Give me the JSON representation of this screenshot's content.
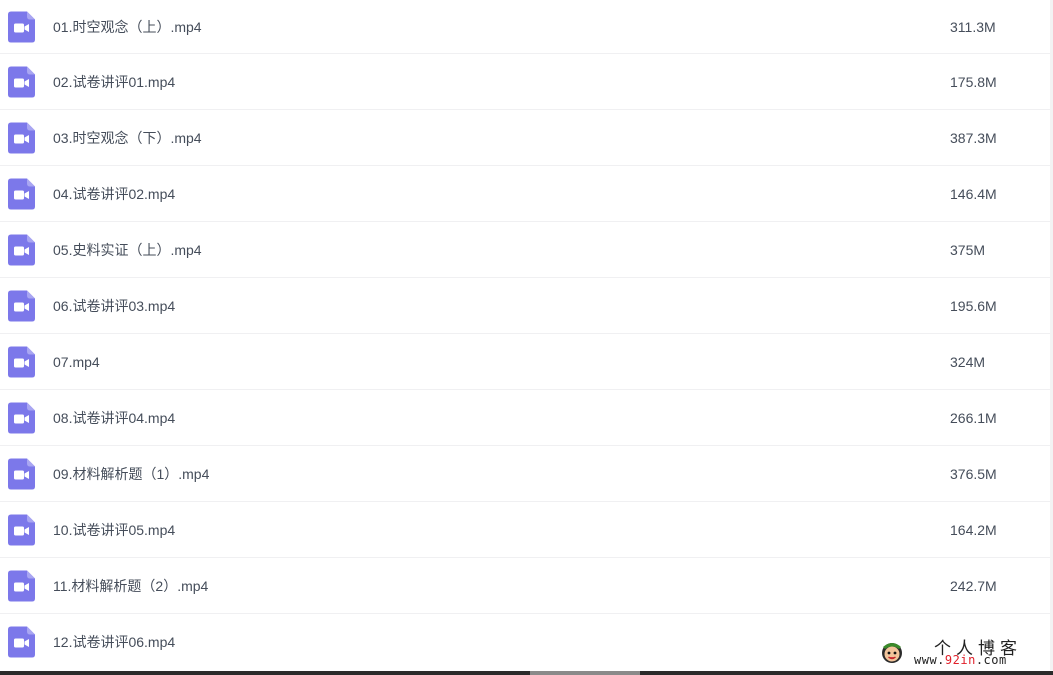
{
  "files": [
    {
      "name": "01.时空观念（上）.mp4",
      "size": "311.3M",
      "icon": "video-file-icon"
    },
    {
      "name": "02.试卷讲评01.mp4",
      "size": "175.8M",
      "icon": "video-file-icon"
    },
    {
      "name": "03.时空观念（下）.mp4",
      "size": "387.3M",
      "icon": "video-file-icon"
    },
    {
      "name": "04.试卷讲评02.mp4",
      "size": "146.4M",
      "icon": "video-file-icon"
    },
    {
      "name": "05.史料实证（上）.mp4",
      "size": "375M",
      "icon": "video-file-icon"
    },
    {
      "name": "06.试卷讲评03.mp4",
      "size": "195.6M",
      "icon": "video-file-icon"
    },
    {
      "name": "07.mp4",
      "size": "324M",
      "icon": "video-file-icon"
    },
    {
      "name": "08.试卷讲评04.mp4",
      "size": "266.1M",
      "icon": "video-file-icon"
    },
    {
      "name": "09.材料解析题（1）.mp4",
      "size": "376.5M",
      "icon": "video-file-icon"
    },
    {
      "name": "10.试卷讲评05.mp4",
      "size": "164.2M",
      "icon": "video-file-icon"
    },
    {
      "name": "11.材料解析题（2）.mp4",
      "size": "242.7M",
      "icon": "video-file-icon"
    },
    {
      "name": "12.试卷讲评06.mp4",
      "size": "",
      "icon": "video-file-icon"
    }
  ],
  "watermark": {
    "title": "个人博客",
    "url_prefix": "www.",
    "url_highlight": "92in",
    "url_suffix": ".com"
  },
  "colors": {
    "icon_accent": "#7c78ea",
    "text": "#454d5a",
    "divider": "#f0f0f2",
    "watermark_highlight": "#e0202a"
  }
}
